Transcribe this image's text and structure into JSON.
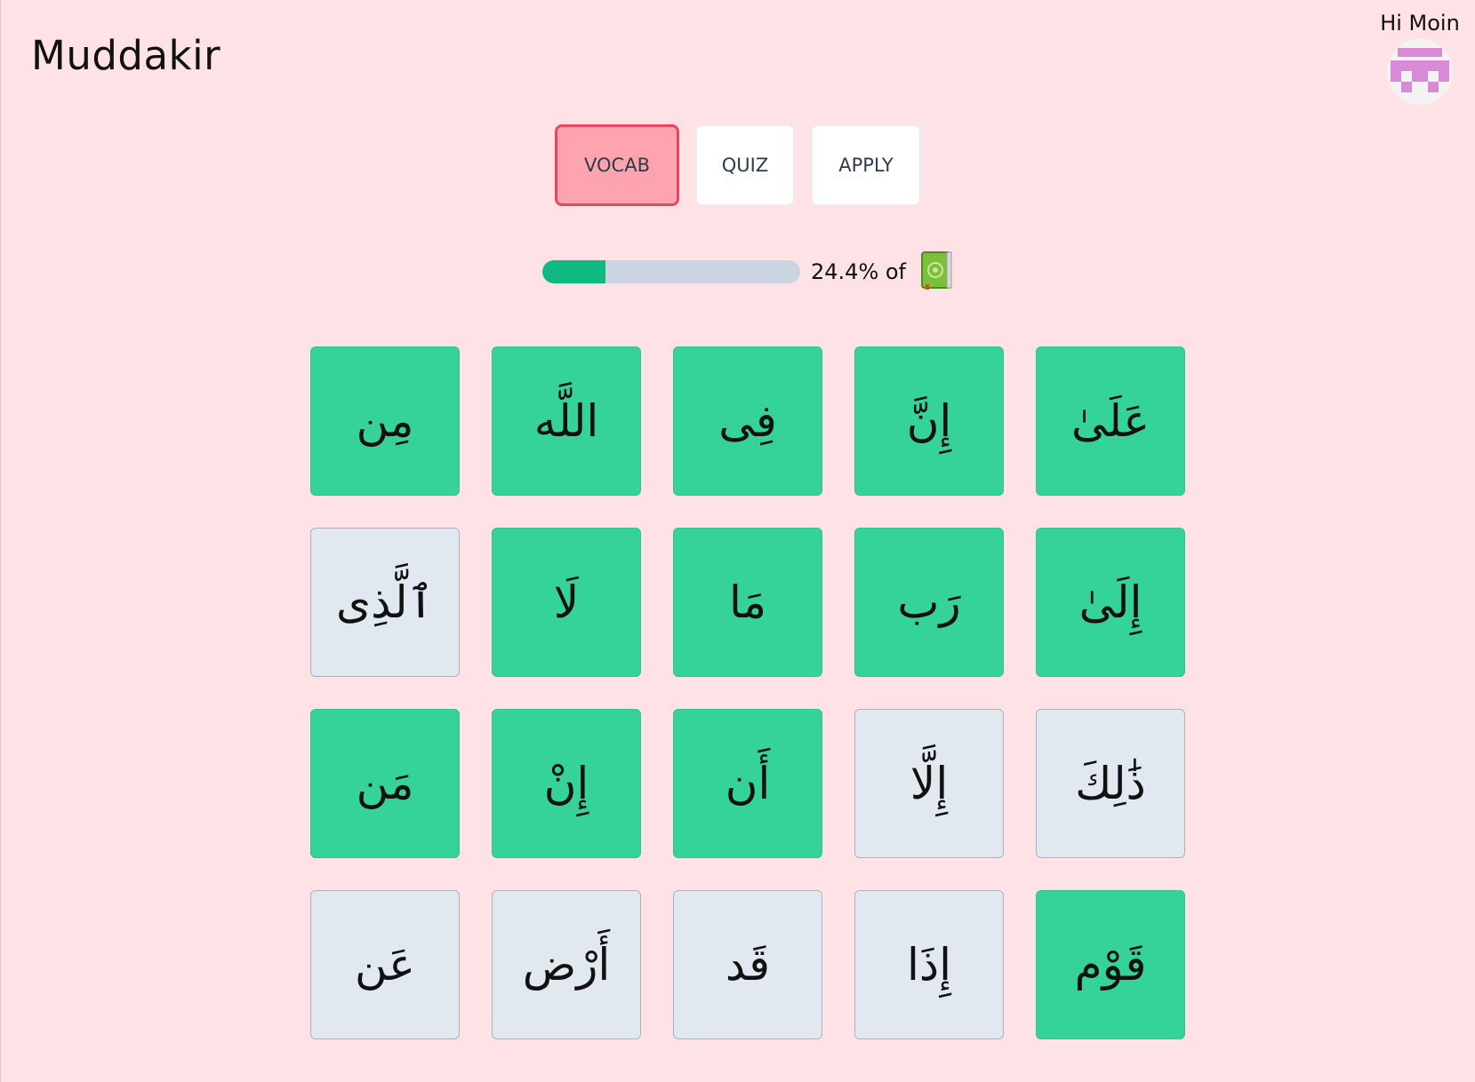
{
  "app": {
    "title": "Muddakir"
  },
  "user": {
    "greeting": "Hi Moin",
    "avatar_icon": "pixel-avatar-icon"
  },
  "tabs": [
    {
      "label": "VOCAB",
      "active": true
    },
    {
      "label": "QUIZ",
      "active": false
    },
    {
      "label": "APPLY",
      "active": false
    }
  ],
  "progress": {
    "percent": 24.4,
    "label": "24.4% of",
    "icon": "quran-book-icon"
  },
  "colors": {
    "known": "#36d399",
    "unknown": "#e2e8f0",
    "accent": "#e8475f",
    "progress": "#10b981"
  },
  "words": [
    {
      "text": "مِن",
      "known": true
    },
    {
      "text": "اللَّه",
      "known": true
    },
    {
      "text": "فِى",
      "known": true
    },
    {
      "text": "إِنَّ",
      "known": true
    },
    {
      "text": "عَلَىٰ",
      "known": true
    },
    {
      "text": "ٱلَّذِى",
      "known": false
    },
    {
      "text": "لَا",
      "known": true
    },
    {
      "text": "مَا",
      "known": true
    },
    {
      "text": "رَب",
      "known": true
    },
    {
      "text": "إِلَىٰ",
      "known": true
    },
    {
      "text": "مَن",
      "known": true
    },
    {
      "text": "إِنْ",
      "known": true
    },
    {
      "text": "أَن",
      "known": true
    },
    {
      "text": "إِلَّا",
      "known": false
    },
    {
      "text": "ذَٰلِكَ",
      "known": false
    },
    {
      "text": "عَن",
      "known": false
    },
    {
      "text": "أَرْض",
      "known": false
    },
    {
      "text": "قَد",
      "known": false
    },
    {
      "text": "إِذَا",
      "known": false
    },
    {
      "text": "قَوْم",
      "known": true
    }
  ]
}
